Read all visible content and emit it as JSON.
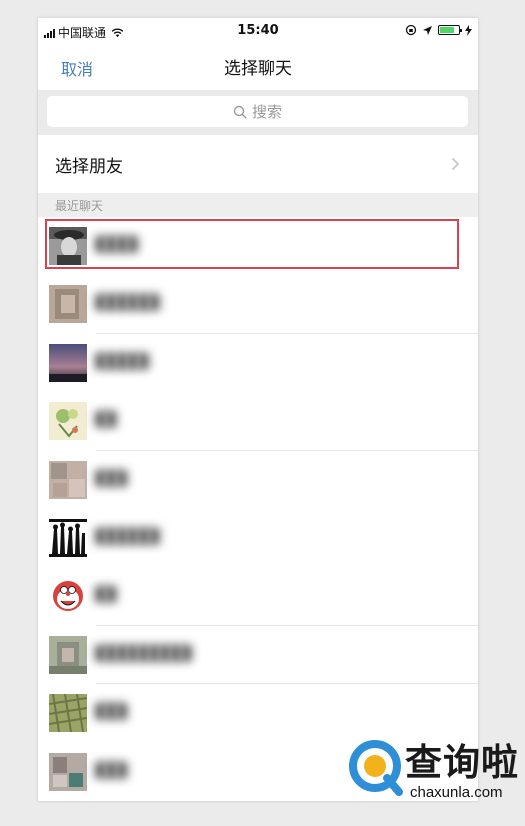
{
  "status_bar": {
    "carrier": "中国联通",
    "time": "15:40",
    "battery_level": 0.75
  },
  "nav": {
    "cancel_label": "取消",
    "title": "选择聊天"
  },
  "search": {
    "placeholder": "搜索"
  },
  "select_friend": {
    "label": "选择朋友"
  },
  "recent_section": {
    "label": "最近聊天"
  },
  "recent_chats": [
    {
      "name": "",
      "avatar": "portrait-bw",
      "highlighted": true
    },
    {
      "name": "",
      "avatar": "blurred-face"
    },
    {
      "name": "",
      "avatar": "sunset"
    },
    {
      "name": "",
      "avatar": "drawing"
    },
    {
      "name": "",
      "avatar": "blurred-group"
    },
    {
      "name": "",
      "avatar": "silhouettes"
    },
    {
      "name": "",
      "avatar": "doraemon"
    },
    {
      "name": "",
      "avatar": "blurred-person"
    },
    {
      "name": "",
      "avatar": "stone-texture"
    },
    {
      "name": "",
      "avatar": "blurred-face-2"
    }
  ],
  "watermark": {
    "text": "查询啦",
    "url": "chaxunla.com"
  },
  "colors": {
    "accent_link": "#4a7db5",
    "highlight_border": "#d6454d",
    "battery_green": "#4cd964"
  }
}
